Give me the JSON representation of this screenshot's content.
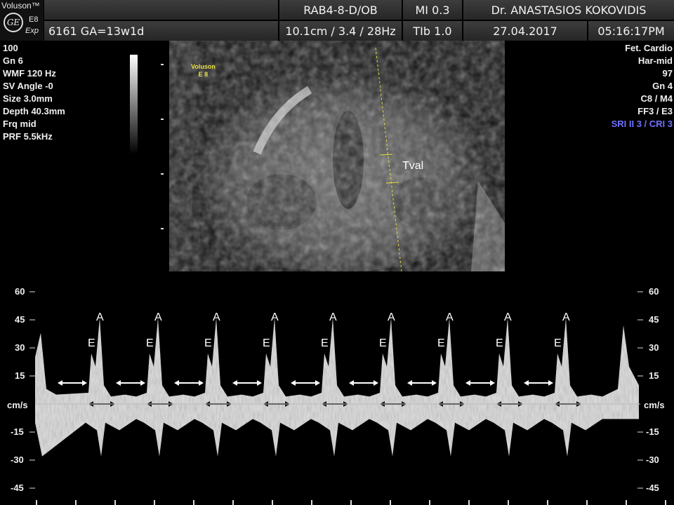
{
  "header": {
    "brand": "Voluson™",
    "model": "E8",
    "model_sub": "Exp",
    "logo": "GE",
    "probe": "RAB4-8-D/OB",
    "mi": "MI  0.3",
    "doctor": "Dr. ANASTASIOS KOKOVIDIS",
    "patient": "6161  GA=13w1d",
    "depth_info": "10.1cm / 3.4 / 28Hz",
    "tib": "TIb  1.0",
    "date": "27.04.2017",
    "time": "05:16:17PM"
  },
  "left_params": [
    "100",
    "Gn  6",
    "WMF 120 Hz",
    "SV Angle -0",
    "Size  3.0mm",
    "Depth 40.3mm",
    "Frq mid",
    "PRF  5.5kHz"
  ],
  "right_params": [
    "Fet. Cardio",
    "Har-mid",
    "97",
    "Gn  4",
    "C8 / M4",
    "FF3 / E3"
  ],
  "right_sri": "SRI II 3 / CRI 3",
  "image_overlay": {
    "voluson": "Voluson",
    "e8": "E 8",
    "tval": "Tval"
  },
  "doppler": {
    "unit": "cm/s",
    "scale": [
      "60",
      "45",
      "30",
      "15",
      "-15",
      "-30",
      "-45"
    ],
    "scale_values": [
      60,
      45,
      30,
      15,
      -15,
      -30,
      -45
    ],
    "wave_labels": {
      "a": "A",
      "e": "E"
    },
    "cycles": 9
  },
  "colors": {
    "accent_blue": "#6f70ff",
    "caliper_yellow": "#e8e040",
    "header_bg": "#333333"
  }
}
